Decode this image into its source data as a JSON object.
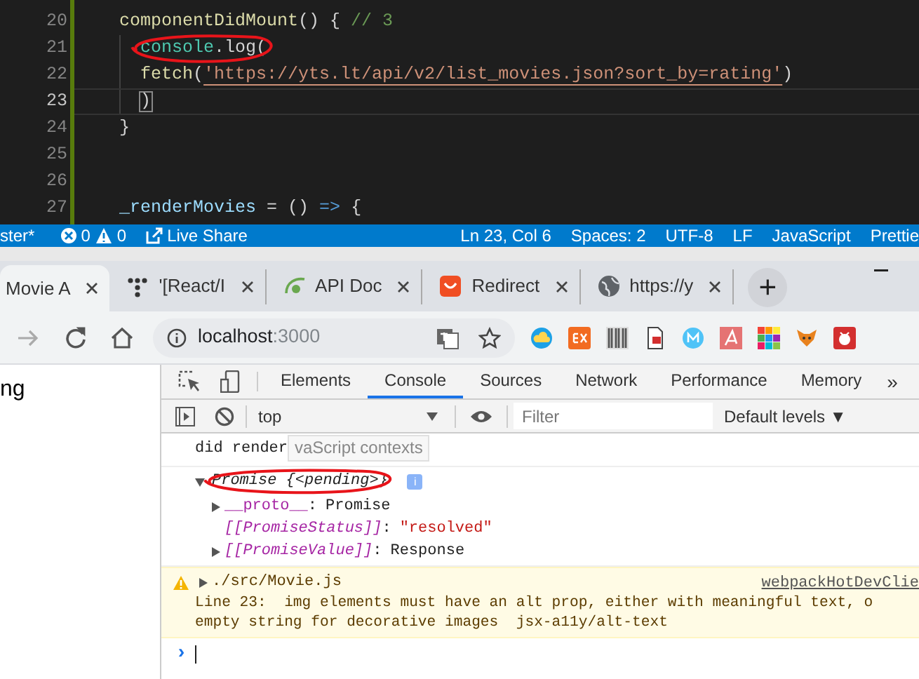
{
  "editor": {
    "lines": [
      {
        "number": "20",
        "current": false,
        "indented": false,
        "circled": false,
        "tokens": [
          {
            "text": "componentDidMount",
            "kind": "function"
          },
          {
            "text": "() { ",
            "kind": "plain"
          },
          {
            "text": "// 3",
            "kind": "comment"
          }
        ]
      },
      {
        "number": "21",
        "current": false,
        "indented": true,
        "circled": true,
        "tokens": [
          {
            "text": "console",
            "kind": "type"
          },
          {
            "text": ".log(",
            "kind": "plain"
          }
        ]
      },
      {
        "number": "22",
        "current": false,
        "indented": true,
        "circled": false,
        "tokens": [
          {
            "text": "fetch",
            "kind": "function"
          },
          {
            "text": "(",
            "kind": "plain"
          },
          {
            "text": "'https://yts.lt/api/v2/list_movies.json?sort_by=rating'",
            "kind": "string"
          },
          {
            "text": ")",
            "kind": "plain"
          }
        ]
      },
      {
        "number": "23",
        "current": true,
        "indented": true,
        "circled": false,
        "tokens": [
          {
            "text": ")",
            "kind": "bracket"
          }
        ]
      },
      {
        "number": "24",
        "current": false,
        "indented": false,
        "circled": false,
        "tokens": [
          {
            "text": "}",
            "kind": "plain"
          }
        ]
      },
      {
        "number": "25",
        "current": false,
        "indented": false,
        "circled": false
      },
      {
        "number": "26",
        "current": false,
        "indented": false,
        "circled": false
      },
      {
        "number": "27",
        "current": false,
        "indented": false,
        "circled": false,
        "tokens": [
          {
            "text": "_renderMovies",
            "kind": "variable"
          },
          {
            "text": " = () ",
            "kind": "plain"
          },
          {
            "text": "=>",
            "kind": "keyword"
          },
          {
            "text": " {",
            "kind": "plain"
          }
        ]
      }
    ]
  },
  "status_bar": {
    "branch": "ster*",
    "errors": "0",
    "warnings": "0",
    "live_share": "Live Share",
    "right": [
      "Ln 23, Col 6",
      "Spaces: 2",
      "UTF-8",
      "LF",
      "JavaScript",
      "Prettie"
    ]
  },
  "browser": {
    "tabs": [
      {
        "title": "Movie A",
        "selected": true
      },
      {
        "title": "'[React/I",
        "selected": false
      },
      {
        "title": "API Doc",
        "selected": false
      },
      {
        "title": "Redirect",
        "selected": false
      },
      {
        "title": "https://y",
        "selected": false
      }
    ],
    "new_tab": "+",
    "address": {
      "host": "localhost",
      "port": ":3000"
    }
  },
  "page": {
    "text": "ng"
  },
  "devtools": {
    "tabs": [
      {
        "label": "Elements",
        "selected": false
      },
      {
        "label": "Console",
        "selected": true
      },
      {
        "label": "Sources",
        "selected": false
      },
      {
        "label": "Network",
        "selected": false
      },
      {
        "label": "Performance",
        "selected": false
      },
      {
        "label": "Memory",
        "selected": false
      }
    ],
    "more": "»",
    "context": "top",
    "filter_placeholder": "Filter",
    "levels": "Default levels ▼",
    "tooltip": "vaScript contexts",
    "messages": [
      {
        "kind": "log",
        "text": "did render"
      },
      {
        "kind": "object",
        "text": "Promise {<pending>}",
        "badge": "i",
        "expanded": true,
        "highlight": true,
        "children": [
          {
            "key": "__proto__",
            "separator": ":",
            "value": "Promise",
            "kind": "object",
            "expandable": true,
            "internal": false
          },
          {
            "key": "[[PromiseStatus]]",
            "separator": ":",
            "value": "\"resolved\"",
            "kind": "string",
            "expandable": false,
            "internal": true
          },
          {
            "key": "[[PromiseValue]]",
            "separator": ":",
            "value": "Response",
            "kind": "object",
            "expandable": true,
            "internal": true
          }
        ]
      },
      {
        "kind": "warning",
        "source": "./src/Movie.js",
        "link": "webpackHotDevClie",
        "lines": [
          "Line 23:  img elements must have an alt prop, either with meaningful text, o",
          "empty string for decorative images  jsx-a11y/alt-text"
        ]
      }
    ],
    "prompt": "›"
  }
}
